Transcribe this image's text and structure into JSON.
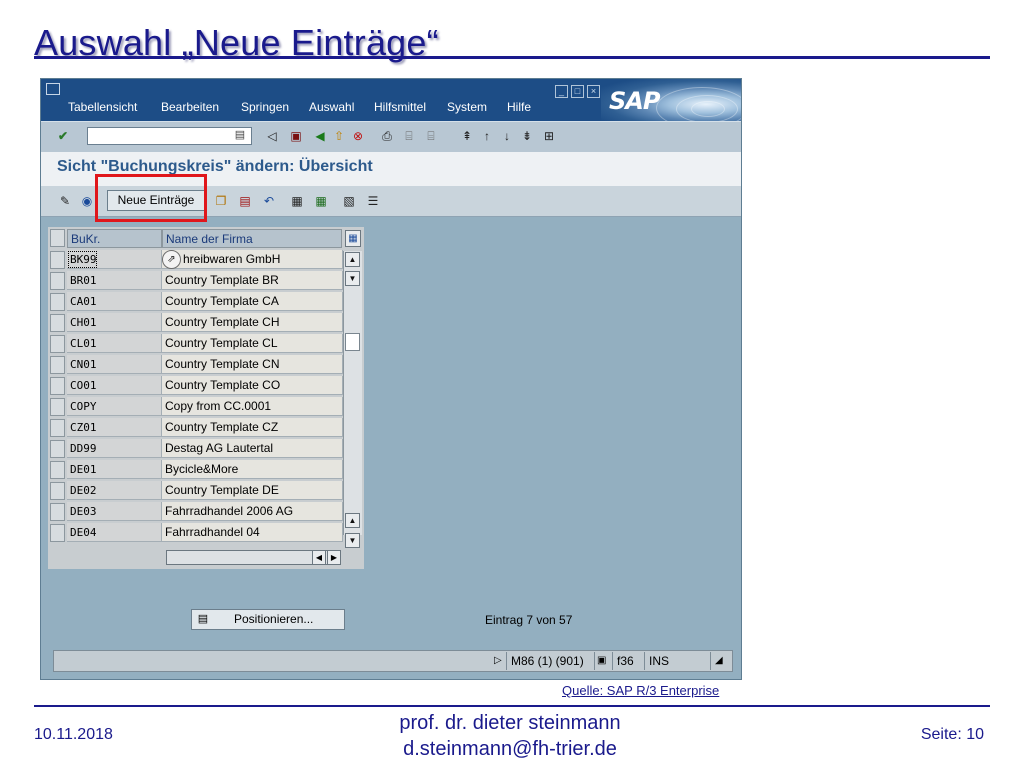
{
  "slide": {
    "title": "Auswahl „Neue Einträge“",
    "source": "Quelle: SAP R/3 Enterprise",
    "footer": {
      "date": "10.11.2018",
      "author_line1": "prof. dr. dieter steinmann",
      "author_line2": "d.steinmann@fh-trier.de",
      "page": "Seite: 10"
    }
  },
  "sap": {
    "logo": "SAP",
    "menu": [
      "Tabellensicht",
      "Bearbeiten",
      "Springen",
      "Auswahl",
      "Hilfsmittel",
      "System",
      "Hilfe"
    ],
    "command_field": {
      "value": ""
    },
    "screen_title": "Sicht \"Buchungskreis\" ändern: Übersicht",
    "app_toolbar": {
      "new_entries_label": "Neue Einträge"
    },
    "table": {
      "headers": [
        "BuKr.",
        "Name der Firma"
      ],
      "rows": [
        {
          "code": "BK99",
          "name": "hreibwaren GmbH"
        },
        {
          "code": "BR01",
          "name": "Country Template BR"
        },
        {
          "code": "CA01",
          "name": "Country Template CA"
        },
        {
          "code": "CH01",
          "name": "Country Template CH"
        },
        {
          "code": "CL01",
          "name": "Country Template CL"
        },
        {
          "code": "CN01",
          "name": "Country Template CN"
        },
        {
          "code": "CO01",
          "name": "Country Template CO"
        },
        {
          "code": "COPY",
          "name": "Copy from CC.0001"
        },
        {
          "code": "CZ01",
          "name": "Country Template CZ"
        },
        {
          "code": "DD99",
          "name": "Destag AG Lautertal"
        },
        {
          "code": "DE01",
          "name": "Bycicle&More"
        },
        {
          "code": "DE02",
          "name": "Country Template DE"
        },
        {
          "code": "DE03",
          "name": "Fahrradhandel 2006 AG"
        },
        {
          "code": "DE04",
          "name": "Fahrradhandel 04"
        }
      ]
    },
    "position_button": "Positionieren...",
    "entry_info": "Eintrag 7 von 57",
    "status": {
      "system": "M86 (1) (901)",
      "server": "f36",
      "mode": "INS"
    }
  }
}
